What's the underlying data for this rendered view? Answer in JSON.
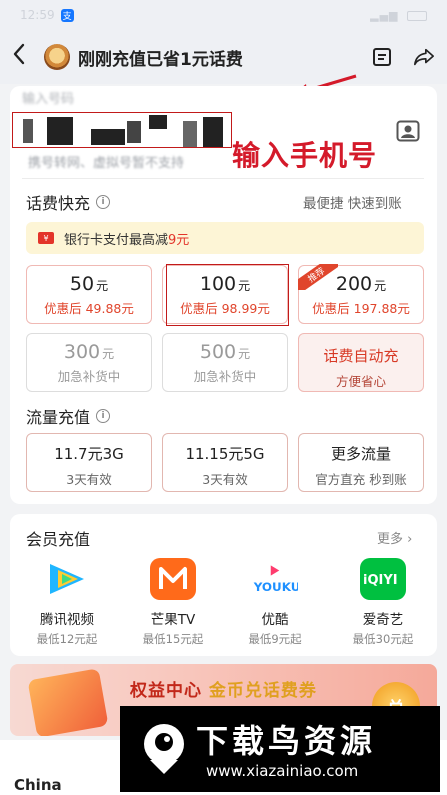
{
  "status_bar": {
    "time": "12:59",
    "app_badge": "支"
  },
  "nav": {
    "title": "刚刚充值已省1元话费"
  },
  "phone": {
    "label": "输入号码",
    "hint": "携号转网、虚拟号暂不支持",
    "annotation": "输入手机号"
  },
  "quick_recharge": {
    "title": "话费快充",
    "right_note": "最便捷 快速到账",
    "promo_text": "银行卡支付最高减",
    "promo_amount": "9元",
    "tiles": [
      {
        "amount": "50",
        "unit": "元",
        "sub": "优惠后 49.88元"
      },
      {
        "amount": "100",
        "unit": "元",
        "sub": "优惠后 98.99元"
      },
      {
        "amount": "200",
        "unit": "元",
        "sub": "优惠后 197.88元",
        "badge": "推荐"
      },
      {
        "amount": "300",
        "unit": "元",
        "sub": "加急补货中"
      },
      {
        "amount": "500",
        "unit": "元",
        "sub": "加急补货中"
      },
      {
        "amount": "话费自动充",
        "unit": "",
        "sub": "方便省心"
      }
    ]
  },
  "data_recharge": {
    "title": "流量充值",
    "tiles": [
      {
        "title": "11.7元3G",
        "sub": "3天有效"
      },
      {
        "title": "11.15元5G",
        "sub": "3天有效"
      },
      {
        "title": "更多流量",
        "sub": "官方直充 秒到账"
      }
    ]
  },
  "membership": {
    "title": "会员充值",
    "more": "更多",
    "apps": [
      {
        "name": "腾讯视频",
        "price": "最低12元起",
        "icon": "tencent-video-icon",
        "color": "#1fb6ff"
      },
      {
        "name": "芒果TV",
        "price": "最低15元起",
        "icon": "mango-tv-icon",
        "color": "#ff6a1a"
      },
      {
        "name": "优酷",
        "price": "最低9元起",
        "icon": "youku-icon",
        "color": "#1e90ff"
      },
      {
        "name": "爱奇艺",
        "price": "最低30元起",
        "icon": "iqiyi-icon",
        "color": "#00c040"
      }
    ]
  },
  "banner": {
    "text_a": "权益中心",
    "text_b": "金币兑话费券",
    "coin": "兑"
  },
  "footer": {
    "brand": "China"
  },
  "watermark": {
    "title": "下载鸟资源",
    "url": "www.xiazainiao.com"
  }
}
